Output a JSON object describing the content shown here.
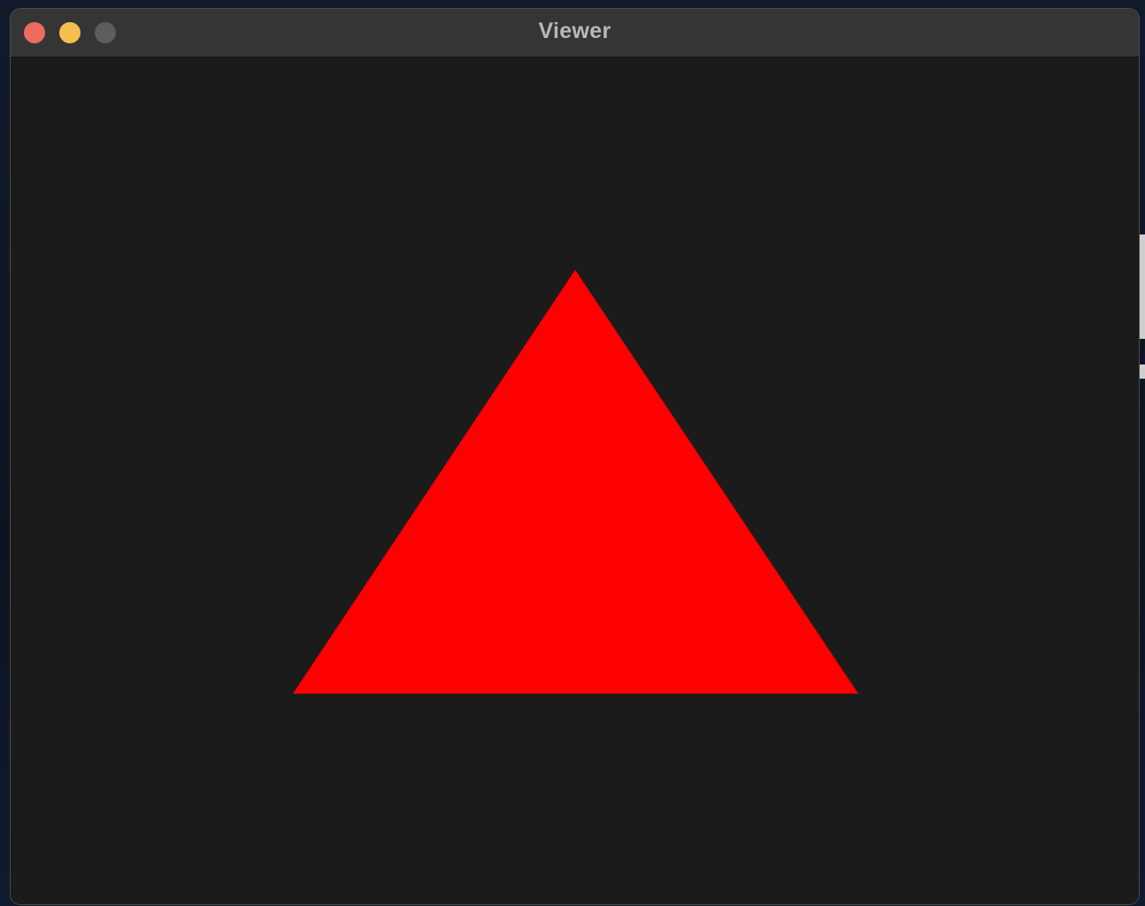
{
  "window": {
    "title": "Viewer"
  },
  "traffic_lights": {
    "close_color": "#ec6a5e",
    "minimize_color": "#f4bf4f",
    "zoom_color": "#5d5d5f"
  },
  "scene": {
    "background_color": "#1b1b1b",
    "shape": "triangle",
    "fill_color": "#ff0000"
  }
}
